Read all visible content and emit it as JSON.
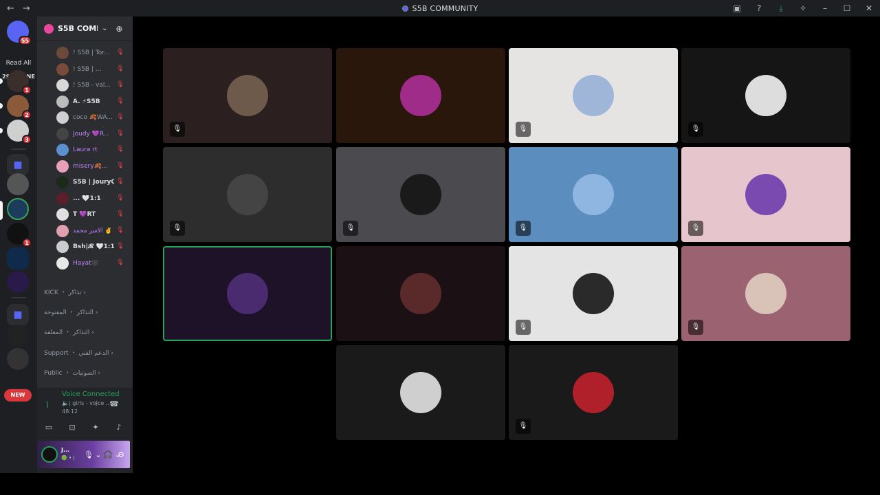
{
  "titlebar": {
    "back_icon": "←",
    "forward_icon": "→",
    "title": "S5B COMMUNITY",
    "icons": [
      "inbox-icon",
      "help-icon",
      "download-icon",
      "leaf-icon"
    ],
    "min": "–",
    "max": "☐",
    "close": "✕"
  },
  "guilds": {
    "home_badge": "55",
    "read_all": "Read All",
    "online": "29 ONLINE",
    "dm_badges": [
      "1",
      "2",
      "3"
    ],
    "server_badge": "1",
    "new_badge": "NEW"
  },
  "server": {
    "name": "S5B COMMUNITY",
    "members": [
      {
        "name": "! S5B | Tor...",
        "color": "#6b4a3a",
        "style": ""
      },
      {
        "name": "! S5B | ...",
        "color": "#7a4a3a",
        "style": ""
      },
      {
        "name": "! S5B - val...",
        "color": "#d8d8d8",
        "style": ""
      },
      {
        "name": "A. ⚡S5B",
        "color": "#bbbbbb",
        "style": "b"
      },
      {
        "name": "coco 🍂WA...",
        "color": "#d0d0d0",
        "style": ""
      },
      {
        "name": "Joudy 💜R...",
        "color": "#444",
        "style": "pink"
      },
      {
        "name": "Laura rt",
        "color": "#5b8fd0",
        "style": "pink"
      },
      {
        "name": "misery🍂...",
        "color": "#e8a0b8",
        "style": "pink"
      },
      {
        "name": "S5B | JouryQ8",
        "color": "#1b2b1b",
        "style": "b"
      },
      {
        "name": "... 🤍1:1",
        "color": "#5a1f2a",
        "style": "b"
      },
      {
        "name": "T 💜RT",
        "color": "#e0e0e0",
        "style": "b"
      },
      {
        "name": "الأمير محمد ✌️",
        "color": "#e0a0b0",
        "style": "pink"
      },
      {
        "name": "Bsh|𝓡 🤍1:1",
        "color": "#cccccc",
        "style": "b"
      },
      {
        "name": "Hayat🕸️",
        "color": "#e8e8e8",
        "style": "pink"
      }
    ],
    "categories": [
      "KICK ・ تذاكر ›",
      "التذاكر ・ المفتوحة ›",
      "التذاكر ・ المغلقة ›",
      "Support ・ الدعم الفني ›",
      "Public ・ الصوتيات ›"
    ]
  },
  "voice": {
    "status": "Voice Connected",
    "channel": "🔈| girls - voice ...",
    "elapsed": "48:12"
  },
  "user": {
    "name": "J...",
    "status": "🟢 • |"
  },
  "stage": {
    "tiles": [
      {
        "bg": "#2b1f1f",
        "av": "#6e5a4a",
        "muted": true
      },
      {
        "bg": "#2a170c",
        "av": "#a02c8a",
        "muted": false
      },
      {
        "bg": "#e6e3e3",
        "av": "#9fb6d8",
        "muted": true
      },
      {
        "bg": "#151515",
        "av": "#dddddd",
        "muted": true
      },
      {
        "bg": "#2d2d2d",
        "av": "#444444",
        "muted": true
      },
      {
        "bg": "#4b4a4f",
        "av": "#1a1a1a",
        "muted": true
      },
      {
        "bg": "#5b8dbf",
        "av": "#8fb6e0",
        "muted": true
      },
      {
        "bg": "#e6c6cc",
        "av": "#7a4ab0",
        "muted": true
      },
      {
        "bg": "#1e1228",
        "av": "#4b2b70",
        "muted": false,
        "speaking": true
      },
      {
        "bg": "#1b1014",
        "av": "#5a2a2a",
        "muted": false
      },
      {
        "bg": "#e4e4e4",
        "av": "#2a2a2a",
        "muted": true
      },
      {
        "bg": "#9b6371",
        "av": "#d9c3b8",
        "muted": true
      },
      {
        "bg": "#1a1a1a",
        "av": "#cfcfcf",
        "muted": false
      },
      {
        "bg": "#1a1a1a",
        "av": "#b0202a",
        "muted": true
      }
    ]
  }
}
